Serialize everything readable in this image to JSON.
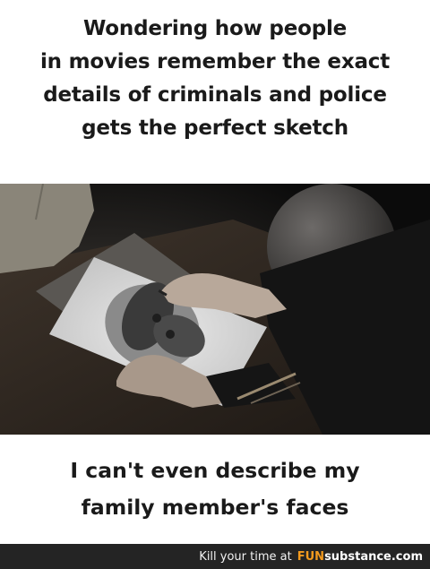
{
  "top_caption": {
    "lines": [
      "Wondering how people",
      "in movies remember the exact",
      "details of criminals and police",
      "gets the perfect sketch"
    ]
  },
  "bottom_caption": {
    "lines": [
      "I can't even describe my",
      "family member's faces"
    ]
  },
  "footer": {
    "tagline": "Kill your time at",
    "brand_fun": "FUN",
    "brand_substance": "substance.com"
  },
  "colors": {
    "footer_bg": "#242424",
    "brand_orange": "#f39a1e",
    "caption_text": "#1a1a1a"
  }
}
